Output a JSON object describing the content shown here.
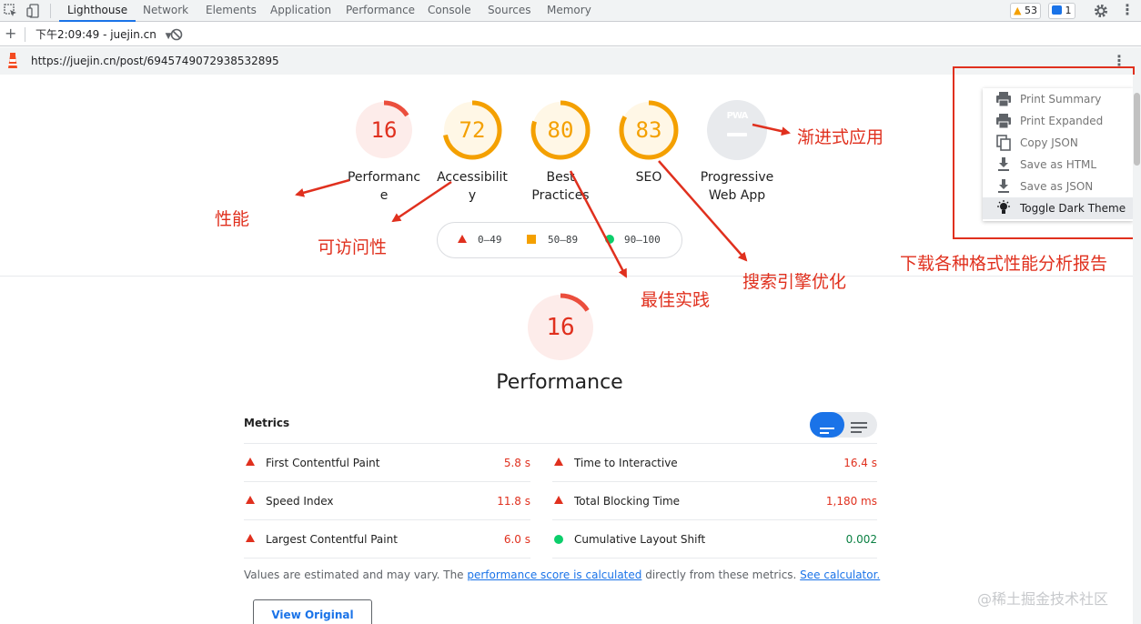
{
  "devtools": {
    "tabs": [
      "Lighthouse",
      "Network",
      "Elements",
      "Application",
      "Performance",
      "Console",
      "Sources",
      "Memory"
    ],
    "active_tab": "Lighthouse",
    "warnings_count": "53",
    "messages_count": "1"
  },
  "report_bar": {
    "add_label": "+",
    "report_selector": "下午2:09:49 - juejin.cn"
  },
  "url_bar": {
    "url": "https://juejin.cn/post/6945749072938532895"
  },
  "gauges": [
    {
      "score": "16",
      "label": "Performance",
      "value": 16,
      "color": "#eb4e3d",
      "bg": "#fdecea"
    },
    {
      "score": "72",
      "label": "Accessibility",
      "value": 72,
      "color": "#f4a000",
      "bg": "#fff7e6"
    },
    {
      "score": "80",
      "label": "Best Practices",
      "value": 80,
      "color": "#f4a000",
      "bg": "#fff7e6"
    },
    {
      "score": "83",
      "label": "SEO",
      "value": 83,
      "color": "#f4a000",
      "bg": "#fff7e6"
    }
  ],
  "pwa": {
    "badge": "PWA",
    "label": "Progressive Web App"
  },
  "legend": {
    "low": "0–49",
    "mid": "50–89",
    "high": "90–100"
  },
  "annotations": {
    "performance": "性能",
    "accessibility": "可访问性",
    "best_practices": "最佳实践",
    "seo": "搜索引擎优化",
    "pwa": "渐进式应用",
    "menu": "下载各种格式性能分析报告"
  },
  "menu": {
    "items": [
      {
        "label": "Print Summary",
        "icon": "printer-icon"
      },
      {
        "label": "Print Expanded",
        "icon": "printer-icon"
      },
      {
        "label": "Copy JSON",
        "icon": "copy-icon"
      },
      {
        "label": "Save as HTML",
        "icon": "download-icon"
      },
      {
        "label": "Save as JSON",
        "icon": "download-icon"
      },
      {
        "label": "Toggle Dark Theme",
        "icon": "lightbulb-icon"
      }
    ]
  },
  "performance_section": {
    "score": "16",
    "value": 16,
    "title": "Performance",
    "metrics_heading": "Metrics",
    "metrics_left": [
      {
        "name": "First Contentful Paint",
        "value": "5.8 s",
        "status": "fail"
      },
      {
        "name": "Speed Index",
        "value": "11.8 s",
        "status": "fail"
      },
      {
        "name": "Largest Contentful Paint",
        "value": "6.0 s",
        "status": "fail"
      }
    ],
    "metrics_right": [
      {
        "name": "Time to Interactive",
        "value": "16.4 s",
        "status": "fail"
      },
      {
        "name": "Total Blocking Time",
        "value": "1,180 ms",
        "status": "fail"
      },
      {
        "name": "Cumulative Layout Shift",
        "value": "0.002",
        "status": "pass"
      }
    ],
    "note_prefix": "Values are estimated and may vary. The ",
    "note_link1": "performance score is calculated",
    "note_middle": " directly from these metrics. ",
    "note_link2": "See calculator.",
    "view_trace_button": "View Original Trace"
  },
  "watermark": "@稀土掘金技术社区"
}
